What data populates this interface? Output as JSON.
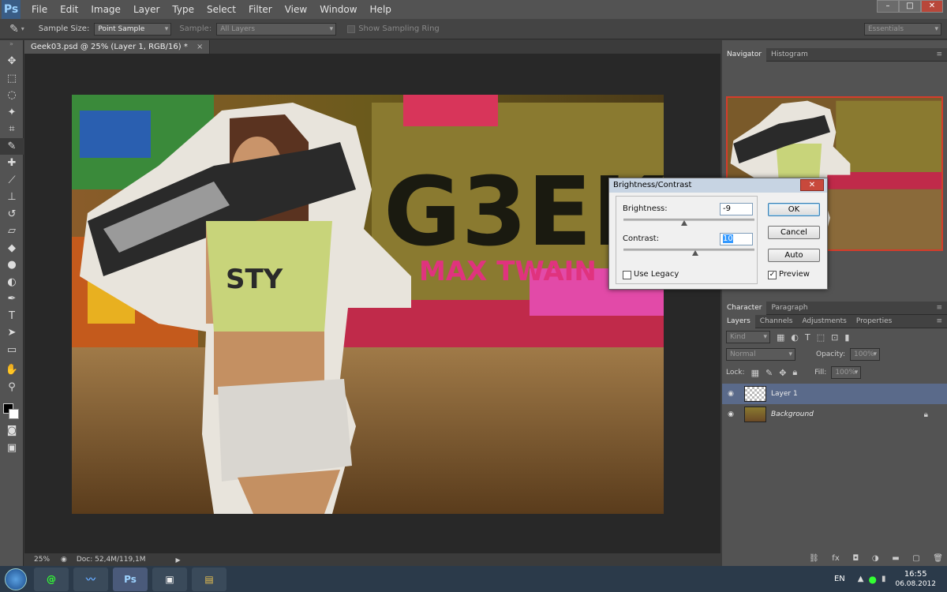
{
  "app": {
    "logo": "Ps"
  },
  "menu": [
    "File",
    "Edit",
    "Image",
    "Layer",
    "Type",
    "Select",
    "Filter",
    "View",
    "Window",
    "Help"
  ],
  "window_controls": {
    "minimize": "–",
    "maximize": "□",
    "close": "✕"
  },
  "options": {
    "sample_size_label": "Sample Size:",
    "sample_size_value": "Point Sample",
    "sample_label": "Sample:",
    "sample_value": "All Layers",
    "sampling_ring_label": "Show Sampling Ring",
    "workspace": "Essentials"
  },
  "document": {
    "tab_title": "Geek03.psd @ 25% (Layer 1, RGB/16) *",
    "tab_close": "×"
  },
  "status": {
    "zoom": "25%",
    "doc_size": "Doc: 52,4M/119,1M"
  },
  "canvas_art": {
    "text1": "G3EK",
    "text2": "MAX TWAIN",
    "text3": "STY"
  },
  "navigator": {
    "tabs": [
      "Navigator",
      "Histogram"
    ]
  },
  "char_tabs": [
    "Character",
    "Paragraph"
  ],
  "layers_panel": {
    "tabs": [
      "Layers",
      "Channels",
      "Adjustments",
      "Properties"
    ],
    "kind": "Kind",
    "blend_mode": "Normal",
    "opacity_label": "Opacity:",
    "opacity_value": "100%",
    "lock_label": "Lock:",
    "fill_label": "Fill:",
    "fill_value": "100%",
    "layers": [
      {
        "name": "Layer 1"
      },
      {
        "name": "Background"
      }
    ]
  },
  "dialog": {
    "title": "Brightness/Contrast",
    "brightness_label": "Brightness:",
    "brightness_value": "-9",
    "contrast_label": "Contrast:",
    "contrast_value": "10",
    "ok": "OK",
    "cancel": "Cancel",
    "auto": "Auto",
    "use_legacy": "Use Legacy",
    "preview": "Preview",
    "preview_checked": "✓"
  },
  "taskbar": {
    "lang": "EN",
    "time": "16:55",
    "date": "06.08.2012",
    "ps_label": "Ps"
  }
}
